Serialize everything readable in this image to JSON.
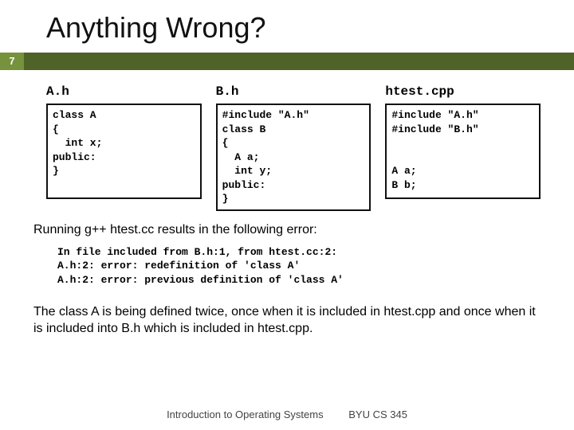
{
  "slide": {
    "title": "Anything Wrong?",
    "number": "7"
  },
  "files": {
    "a": {
      "name": "A.h",
      "code": "class A\n{\n  int x;\npublic:\n}"
    },
    "b": {
      "name": "B.h",
      "code": "#include \"A.h\"\nclass B\n{\n  A a;\n  int y;\npublic:\n}"
    },
    "c": {
      "name": "htest.cpp",
      "code": "#include \"A.h\"\n#include \"B.h\"\n\n\nA a;\nB b;"
    }
  },
  "note1": "Running g++ htest.cc results in the following error:",
  "error_output": "In file included from B.h:1, from htest.cc:2:\nA.h:2: error: redefinition of 'class A'\nA.h:2: error: previous definition of 'class A'",
  "note2": "The class A is being defined twice, once when it is included in htest.cpp and once when it is included into B.h which is included in htest.cpp.",
  "footer": {
    "left": "Introduction to Operating Systems",
    "right": "BYU CS 345"
  }
}
